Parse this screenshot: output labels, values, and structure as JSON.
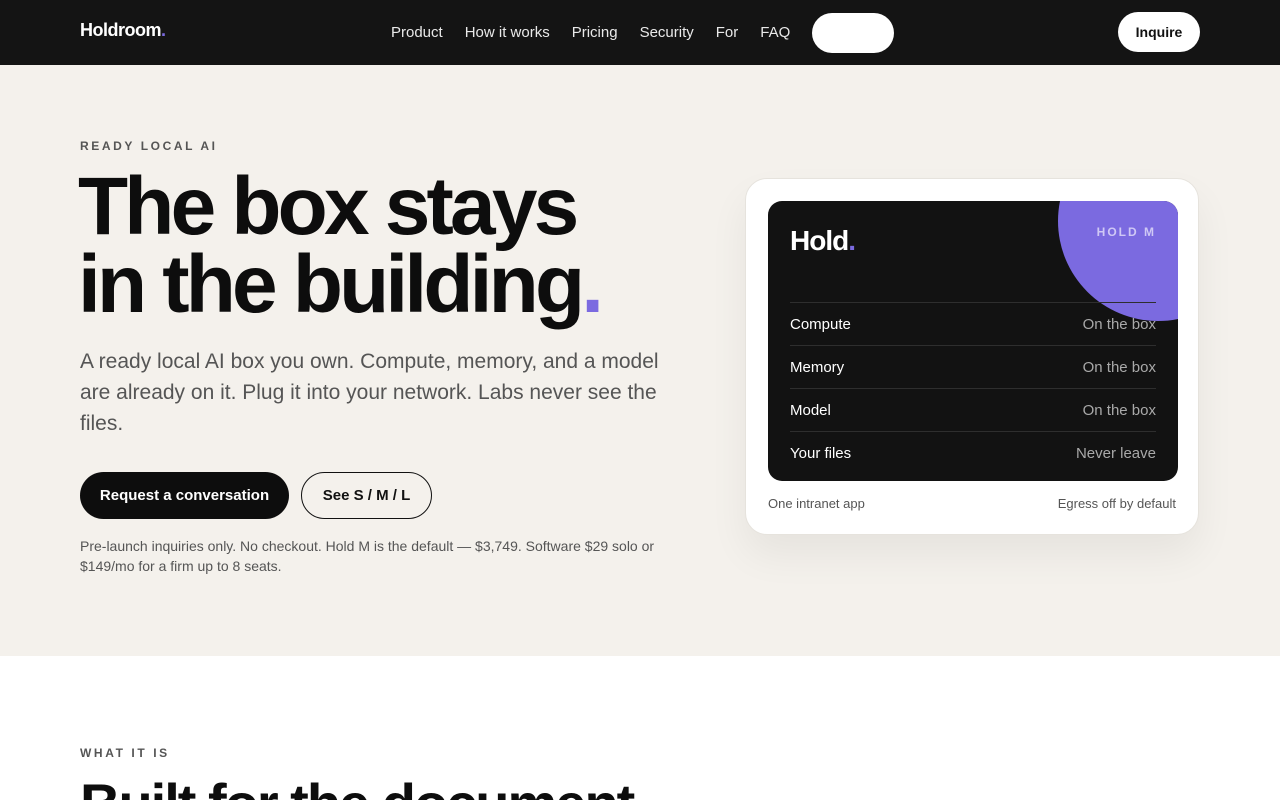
{
  "nav": {
    "logo": "Holdroom",
    "logo_dot": ".",
    "links": [
      "Product",
      "How it works",
      "Pricing",
      "Security",
      "For",
      "FAQ"
    ],
    "cta": "Inquire"
  },
  "hero": {
    "eyebrow": "READY LOCAL AI",
    "headline_line1": "The box stays",
    "headline_line2": "in the building",
    "headline_dot": ".",
    "lede": "A ready local AI box you own. Compute, memory, and a model are already on it. Plug it into your network. Labs never see the files.",
    "primary_button": "Request a conversation",
    "secondary_button": "See S / M / L",
    "fineprint": "Pre-launch inquiries only. No checkout. Hold M is the default — $3,749. Software $29 solo or $149/mo for a firm up to 8 seats."
  },
  "card": {
    "device_logo": "Hold",
    "device_logo_dot": ".",
    "model_tag": "HOLD M",
    "specs": [
      {
        "label": "Compute",
        "value": "On the box"
      },
      {
        "label": "Memory",
        "value": "On the box"
      },
      {
        "label": "Model",
        "value": "On the box"
      },
      {
        "label": "Your files",
        "value": "Never leave"
      }
    ],
    "footer_left": "One intranet app",
    "footer_right": "Egress off by default"
  },
  "section2": {
    "eyebrow": "WHAT IT IS",
    "heading": "Built for the document"
  },
  "colors": {
    "accent": "#7b6ae0",
    "nav_bg": "#141414",
    "page_bg": "#f4f1ec"
  }
}
